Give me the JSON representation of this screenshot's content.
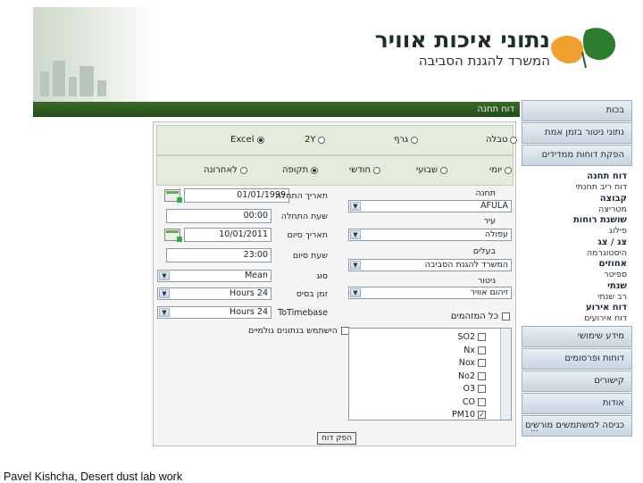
{
  "header": {
    "title": "נתוני איכות אוויר",
    "subtitle": "המשרד להגנת הסביבה"
  },
  "breadcrumb": "דוח תחנה",
  "sidebar": {
    "items_top": [
      "בכות",
      "נתוני ניטור בזמן אמת",
      "הפקת דוחות ממדידים"
    ],
    "sub_items": [
      {
        "text": "דוח תחנה",
        "bold": true
      },
      {
        "text": "דוח ריב תחנתי",
        "bold": false
      },
      {
        "text": "קבוצה",
        "bold": true
      },
      {
        "text": "מטריצה",
        "bold": false
      },
      {
        "text": "שושנת רוחות",
        "bold": true
      },
      {
        "text": "פילוג",
        "bold": false
      },
      {
        "text": "צג / צג",
        "bold": true
      },
      {
        "text": "היסטוגרמה",
        "bold": false
      },
      {
        "text": "אחוזים",
        "bold": true
      },
      {
        "text": "ספיטר",
        "bold": false
      },
      {
        "text": "שנתי",
        "bold": true
      },
      {
        "text": "רב שנתי",
        "bold": false
      },
      {
        "text": "דוח אירוע",
        "bold": true
      },
      {
        "text": "דוח אירועים",
        "bold": false
      }
    ],
    "items_bottom": [
      "מידע שימושי",
      "דוחות ופרסומים",
      "קישורים",
      "אודות",
      "כניסה למשתמשים מורשים"
    ],
    "more": "..."
  },
  "format_row": {
    "options": [
      {
        "label": "טבלה",
        "selected": false
      },
      {
        "label": "גרף",
        "selected": false
      },
      {
        "label": "2Y",
        "selected": false
      },
      {
        "label": "Excel",
        "selected": true
      }
    ]
  },
  "period_row": {
    "options": [
      {
        "label": "יומי",
        "selected": false
      },
      {
        "label": "שבועי",
        "selected": false
      },
      {
        "label": "חודשי",
        "selected": false
      },
      {
        "label": "תקופה",
        "selected": true
      },
      {
        "label": "לאחרונה",
        "selected": false
      }
    ]
  },
  "form": {
    "station_label": "תחנה",
    "station_value": "AFULA",
    "city_label": "עיר",
    "city_value": "עפולה",
    "owner_label": "בעלים",
    "owner_value": "המשרד להגנת הסביבה",
    "monitor_label": "ניטור",
    "monitor_value": "זיהום אוויר",
    "start_date_label": "תאריך התחלה",
    "start_date_value": "01/01/1999",
    "start_time_label": "שעת התחלה",
    "start_time_value": "00:00",
    "end_date_label": "תאריך סיום",
    "end_date_value": "10/01/2011",
    "end_time_label": "שעת סיום",
    "end_time_value": "23:00",
    "type_label": "סוג",
    "type_value": "Mean",
    "time_base_label": "זמן בסיס",
    "time_base_value": "Hours 24",
    "to_timebase_label": "ToTimebase",
    "to_timebase_value": "Hours 24",
    "regular_label": "הישתמש בנתונים גולמיים",
    "all_pollutants_label": "כל המזהמים"
  },
  "pollutants": [
    {
      "name": "SO2",
      "checked": false
    },
    {
      "name": "Nx",
      "checked": false
    },
    {
      "name": "Nox",
      "checked": false
    },
    {
      "name": "No2",
      "checked": false
    },
    {
      "name": "O3",
      "checked": false
    },
    {
      "name": "CO",
      "checked": false
    },
    {
      "name": "PM10",
      "checked": true
    }
  ],
  "produce_button": "הפק דוח",
  "caption": "Pavel Kishcha, Desert dust lab work"
}
